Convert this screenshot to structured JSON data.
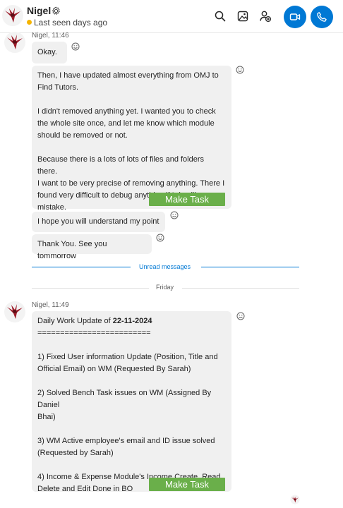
{
  "header": {
    "name": "Nigel",
    "status": "Last seen days ago"
  },
  "colors": {
    "accent": "#0078d4",
    "task_button": "#6aaf4a",
    "away": "#f5b400"
  },
  "icons": [
    "bird-avatar-icon",
    "gear-icon",
    "search-icon",
    "gallery-icon",
    "add-person-icon",
    "video-call-icon",
    "phone-call-icon",
    "emoji-reaction-icon"
  ],
  "group1": {
    "meta": "Nigel, 11:46",
    "msg1": "Okay.",
    "msg2": "Then, I have updated almost everything from OMJ to\nFind Tutors.\n\nI didn't removed anything yet. I wanted you to check\nthe whole site once, and let me know which module\nshould be removed or not.\n\nBecause there is a lots of lots of files and folders there.\nI want to be very precise of removing anything. There I\nfound very difficult to debug anything if I do silly\nmistake.",
    "msg3": "I hope you will understand my point",
    "msg4": "Thank You. See you tommorrow",
    "task_label": "Make Task"
  },
  "unread_label": "Unread messages",
  "day_label": "Friday",
  "group2": {
    "meta": "Nigel, 11:49",
    "title_prefix": "Daily Work Update of ",
    "title_date": "22-11-2024",
    "body": "=========================\n\n1) Fixed User information Update (Position, Title and\nOfficial Email) on WM (Requested By Sarah)\n\n2) Solved Bench Task issues on WM (Assigned By Daniel\nBhai)\n\n3) WM Active employee's email and ID issue solved\n(Requested by Sarah)\n\n4) Income & Expense Module's Income Create, Read,\nDelete and Edit Done in BO",
    "task_label": "Make Task"
  }
}
